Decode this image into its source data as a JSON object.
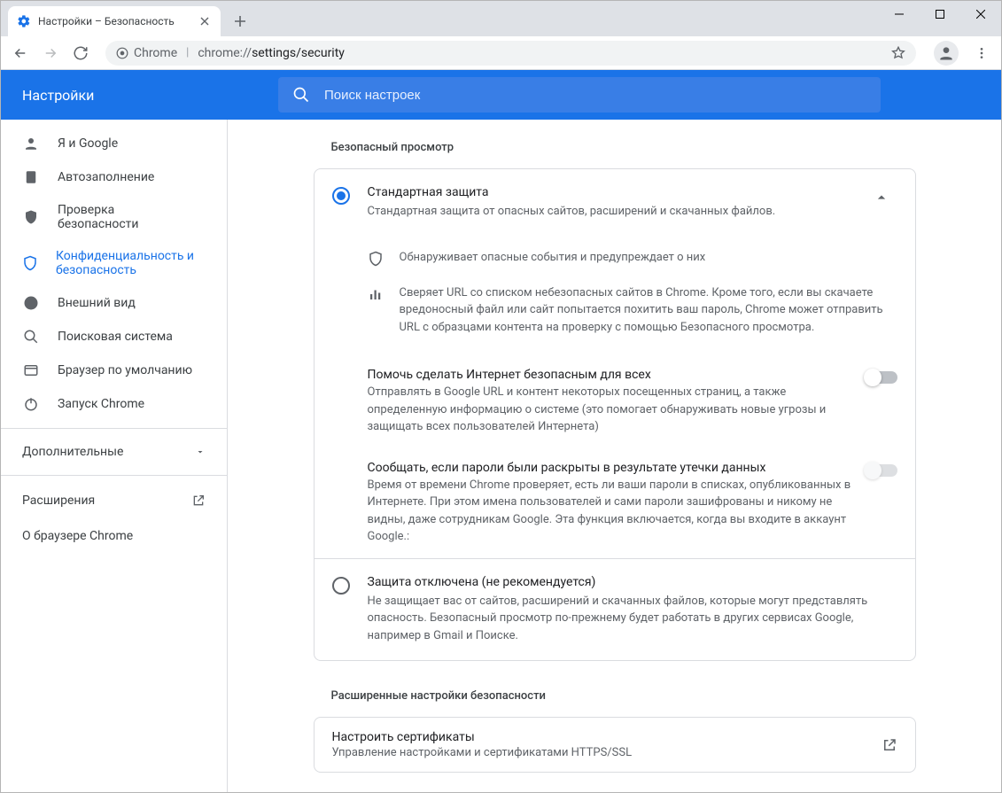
{
  "tab": {
    "title": "Настройки – Безопасность"
  },
  "omnibox": {
    "chip": "Chrome",
    "url_prefix": "chrome://",
    "url_path": "settings/security"
  },
  "appbar": {
    "title": "Настройки",
    "search_placeholder": "Поиск настроек"
  },
  "sidebar": {
    "items": [
      {
        "label": "Я и Google"
      },
      {
        "label": "Автозаполнение"
      },
      {
        "label": "Проверка безопасности"
      },
      {
        "label": "Конфиденциальность и безопасность"
      },
      {
        "label": "Внешний вид"
      },
      {
        "label": "Поисковая система"
      },
      {
        "label": "Браузер по умолчанию"
      },
      {
        "label": "Запуск Chrome"
      }
    ],
    "advanced": "Дополнительные",
    "extensions": "Расширения",
    "about": "О браузере Chrome"
  },
  "main": {
    "section_title": "Безопасный просмотр",
    "standard": {
      "title": "Стандартная защита",
      "sub": "Стандартная защита от опасных сайтов, расширений и скачанных файлов.",
      "d1": "Обнаруживает опасные события и предупреждает о них",
      "d2": "Сверяет URL со списком небезопасных сайтов в Chrome. Кроме того, если вы скачаете вредоносный файл или сайт попытается похитить ваш пароль, Chrome может отправить URL с образцами контента на проверку с помощью Безопасного просмотра."
    },
    "toggle1": {
      "title": "Помочь сделать Интернет безопасным для всех",
      "sub": "Отправлять в Google URL и контент некоторых посещенных страниц, а также определенную информацию о системе (это помогает обнаруживать новые угрозы и защищать всех пользователей Интернета)"
    },
    "toggle2": {
      "title": "Сообщать, если пароли были раскрыты в результате утечки данных",
      "sub": "Время от времени Chrome проверяет, есть ли ваши пароли в списках, опубликованных в Интернете. При этом имена пользователей и сами пароли зашифрованы и никому не видны, даже сотрудникам Google. Эта функция включается, когда вы входите в аккаунт Google.:"
    },
    "off": {
      "title": "Защита отключена (не рекомендуется)",
      "sub": "Не защищает вас от сайтов, расширений и скачанных файлов, которые могут представлять опасность. Безопасный просмотр по-прежнему будет работать в других сервисах Google, например в Gmail и Поиске."
    },
    "adv_title": "Расширенные настройки безопасности",
    "cert": {
      "title": "Настроить сертификаты",
      "sub": "Управление настройками и сертификатами HTTPS/SSL"
    }
  }
}
